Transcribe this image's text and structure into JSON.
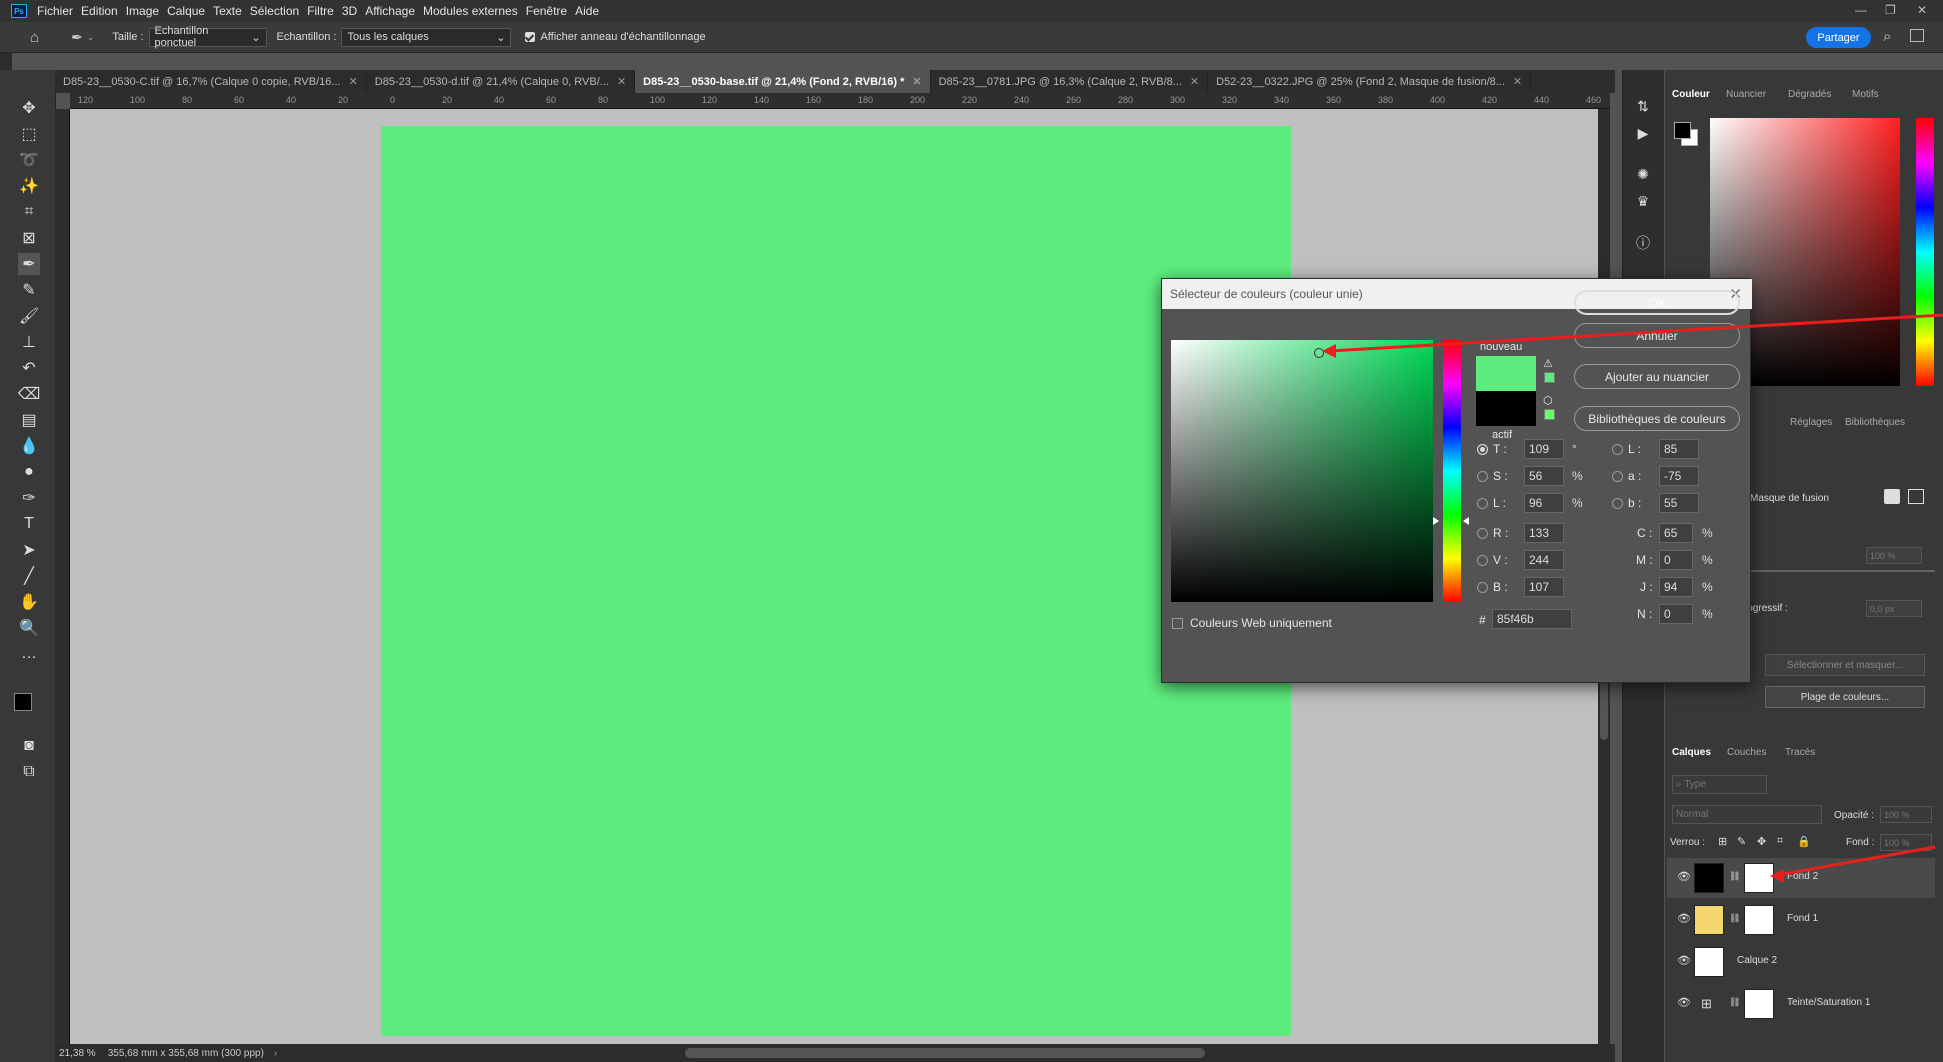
{
  "menubar": {
    "items": [
      "Fichier",
      "Edition",
      "Image",
      "Calque",
      "Texte",
      "Sélection",
      "Filtre",
      "3D",
      "Affichage",
      "Modules externes",
      "Fenêtre",
      "Aide"
    ],
    "logo": "Ps"
  },
  "options": {
    "taille_label": "Taille :",
    "taille_value": "Echantillon ponctuel",
    "echantillon_label": "Echantillon :",
    "echantillon_value": "Tous les calques",
    "ring_label": "Afficher anneau d'échantillonnage",
    "share": "Partager"
  },
  "tabs": [
    {
      "label": "D85-23__0530-C.tif @ 16,7% (Calque 0 copie, RVB/16..."
    },
    {
      "label": "D85-23__0530-d.tif @ 21,4% (Calque 0, RVB/..."
    },
    {
      "label": "D85-23__0530-base.tif @ 21,4% (Fond 2, RVB/16) *"
    },
    {
      "label": "D85-23__0781.JPG @ 16,3% (Calque 2, RVB/8..."
    },
    {
      "label": "D52-23__0322.JPG @ 25% (Fond 2, Masque de fusion/8..."
    }
  ],
  "ruler": [
    "120",
    "100",
    "80",
    "60",
    "40",
    "20",
    "0",
    "20",
    "40",
    "60",
    "80",
    "100",
    "120",
    "140",
    "160",
    "180",
    "200",
    "220",
    "240",
    "260",
    "280",
    "300",
    "320",
    "340",
    "360",
    "380",
    "400",
    "420",
    "440",
    "460"
  ],
  "status": {
    "zoom": "21,38 %",
    "size": "355,68 mm x 355,68 mm (300 ppp)"
  },
  "color_panel": {
    "tabs": [
      "Couleur",
      "Nuancier",
      "Dégradés",
      "Motifs"
    ]
  },
  "adjust_panel": {
    "tabs": [
      "Réglages",
      "Bibliothèques"
    ],
    "fusion": "Masque de fusion",
    "density": "100 %",
    "feather_label": "Contour progressif :",
    "feather": "0,0 px",
    "select_mask": "Sélectionner et masquer...",
    "color_range": "Plage de couleurs..."
  },
  "layers_panel": {
    "tabs": [
      "Calques",
      "Couches",
      "Tracés"
    ],
    "search": "Type",
    "blend": "Normal",
    "opacity_label": "Opacité :",
    "opacity": "100 %",
    "lock_label": "Verrou :",
    "fill_label": "Fond :",
    "fill": "100 %",
    "layers": [
      {
        "name": "Fond 2"
      },
      {
        "name": "Fond 1"
      },
      {
        "name": "Calque 2"
      },
      {
        "name": "Teinte/Saturation 1"
      }
    ]
  },
  "dialog": {
    "title": "Sélecteur de couleurs (couleur unie)",
    "new_label": "nouveau",
    "active_label": "actif",
    "new_color": "#5DED7E",
    "active_color": "#000000",
    "buttons": {
      "ok": "OK",
      "cancel": "Annuler",
      "add_swatch": "Ajouter au nuancier",
      "libraries": "Bibliothèques de couleurs"
    },
    "web_only": "Couleurs Web uniquement",
    "hsb": {
      "h_label": "T :",
      "h": "109",
      "h_unit": "°",
      "s_label": "S :",
      "s": "56",
      "s_unit": "%",
      "b_label": "L :",
      "b": "96",
      "b_unit": "%"
    },
    "rgb": {
      "r_label": "R :",
      "r": "133",
      "g_label": "V :",
      "g": "244",
      "b_label": "B :",
      "b": "107"
    },
    "lab": {
      "l_label": "L :",
      "l": "85",
      "a_label": "a :",
      "a": "-75",
      "b_label": "b :",
      "b": "55"
    },
    "cmyk": {
      "c_label": "C :",
      "c": "65",
      "m_label": "M :",
      "m": "0",
      "y_label": "J :",
      "y": "94",
      "k_label": "N :",
      "k": "0",
      "unit": "%"
    },
    "hex_label": "#",
    "hex": "85f46b"
  }
}
